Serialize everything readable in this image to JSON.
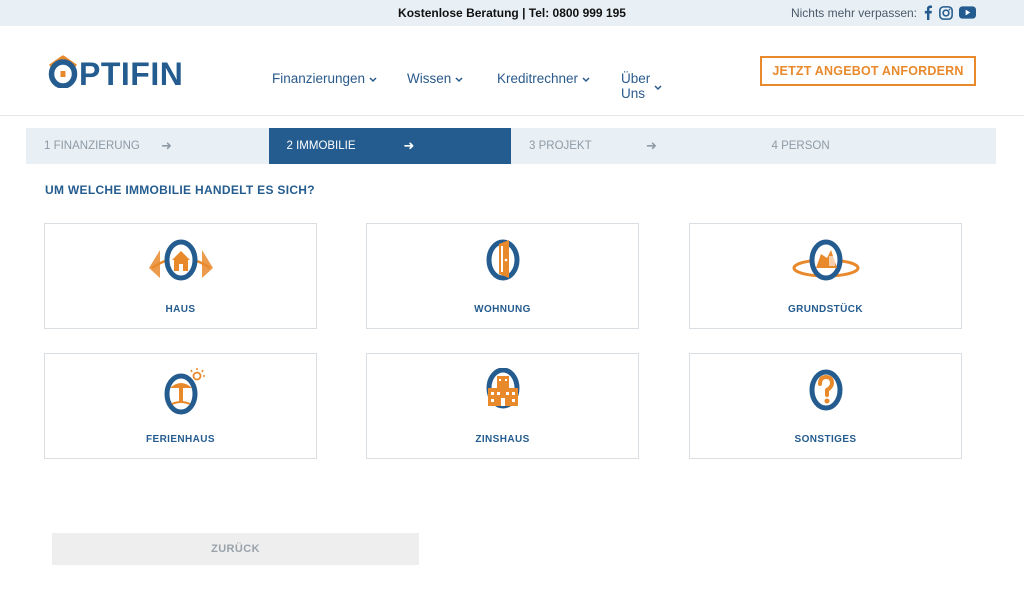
{
  "topbar": {
    "contact": "Kostenlose Beratung | Tel: 0800 999 195",
    "social_label": "Nichts mehr verpassen:",
    "social_icons": [
      "facebook-icon",
      "instagram-icon",
      "youtube-icon"
    ]
  },
  "brand": {
    "name": "OPTIFIN",
    "primary_color": "#245c8f",
    "accent_color": "#e8892c"
  },
  "nav": {
    "items": [
      {
        "label": "Finanzierungen"
      },
      {
        "label": "Wissen"
      },
      {
        "label": "Kreditrechner"
      },
      {
        "label": "Über Uns"
      }
    ],
    "cta": "JETZT ANGEBOT ANFORDERN"
  },
  "steps": [
    {
      "label": "1 FINANZIERUNG",
      "arrow": "➜"
    },
    {
      "label": "2 IMMOBILIE",
      "arrow": "➜"
    },
    {
      "label": "3 PROJEKT",
      "arrow": "➜"
    },
    {
      "label": "4 PERSON",
      "arrow": ""
    }
  ],
  "active_step": 2,
  "question": "UM WELCHE IMMOBILIE HANDELT ES SICH?",
  "options": [
    {
      "label": "HAUS",
      "icon": "house-icon"
    },
    {
      "label": "WOHNUNG",
      "icon": "apartment-door-icon"
    },
    {
      "label": "GRUNDSTÜCK",
      "icon": "land-plot-icon"
    },
    {
      "label": "FERIENHAUS",
      "icon": "holiday-house-icon"
    },
    {
      "label": "ZINSHAUS",
      "icon": "rental-building-icon"
    },
    {
      "label": "SONSTIGES",
      "icon": "question-mark-icon"
    }
  ],
  "back_button": "ZURÜCK"
}
